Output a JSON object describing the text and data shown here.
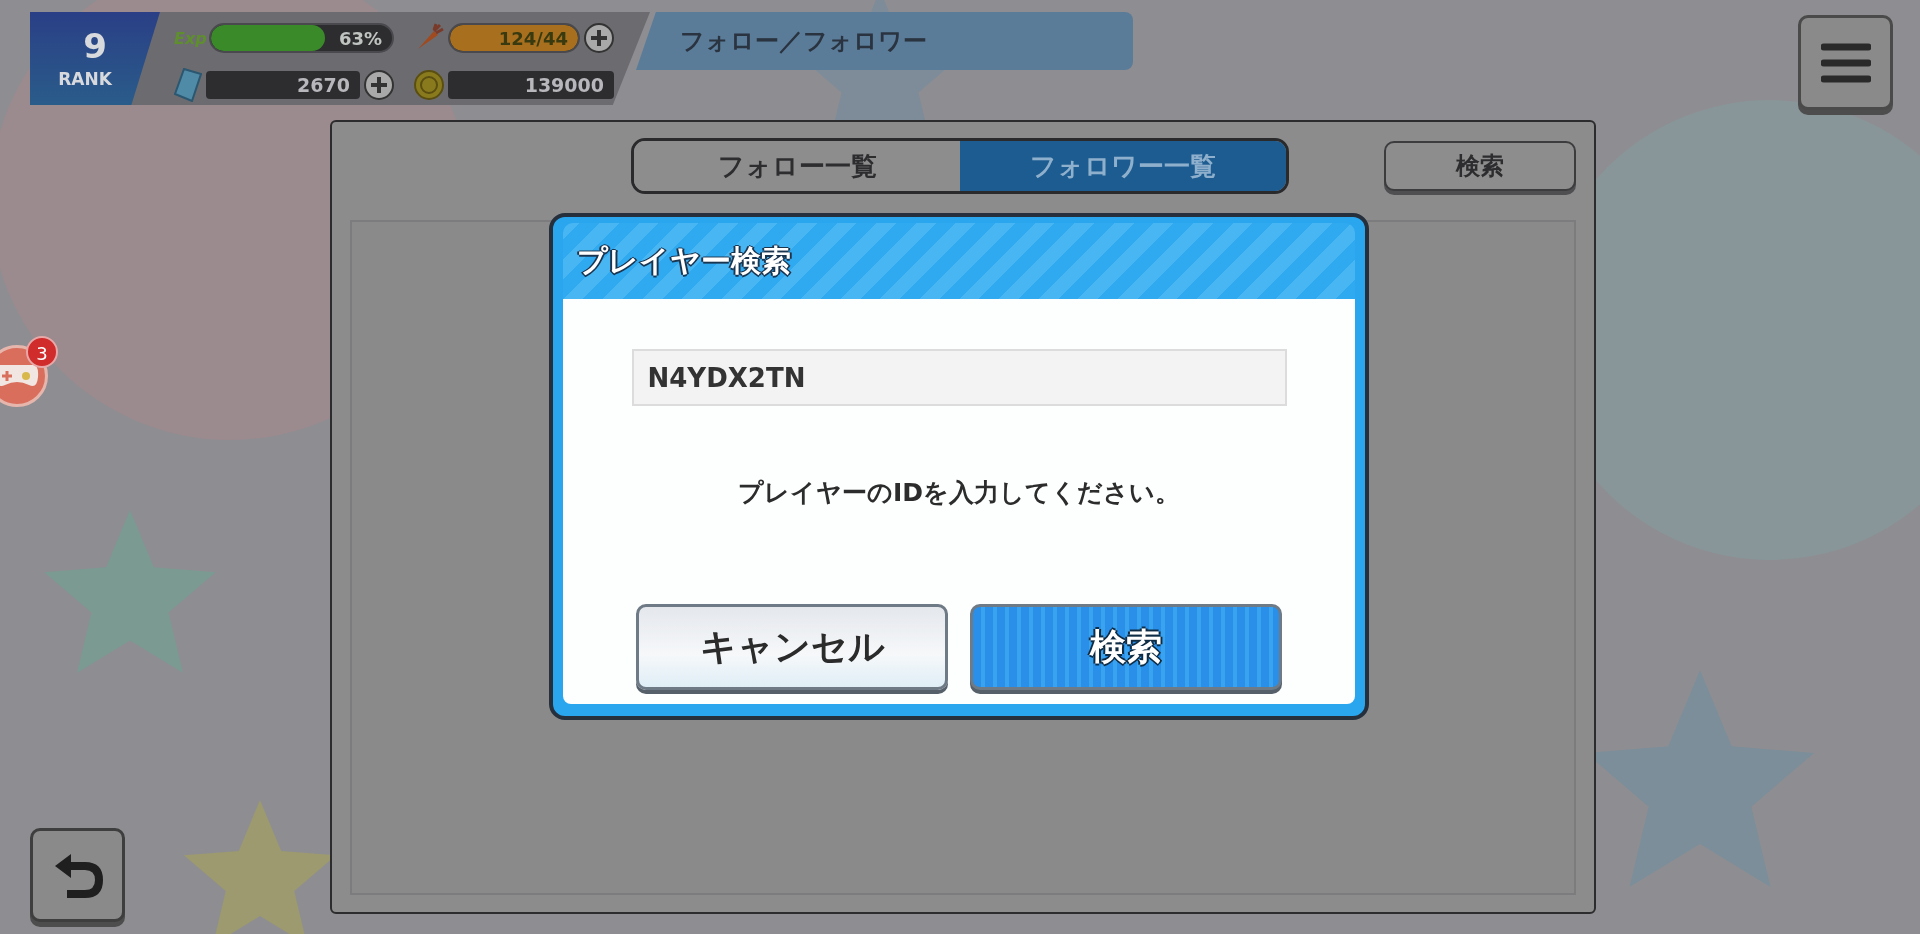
{
  "status": {
    "rank_value": "9",
    "rank_label": "RANK",
    "exp": {
      "label": "Exp",
      "level": 0.63,
      "text": "63%"
    },
    "stamina": {
      "level": 1,
      "text": "124/44"
    },
    "gems": "2670",
    "coins": "139000"
  },
  "title": "フォロー／フォロワー",
  "tabs": [
    {
      "label": "フォロー一覧",
      "selected": false
    },
    {
      "label": "フォロワー一覧",
      "selected": true
    }
  ],
  "search_button": "検索",
  "side_badge": "3",
  "dialog": {
    "title": "プレイヤー検索",
    "input_value": "N4YDX2TN",
    "message": "プレイヤーのIDを入力してください。",
    "buttons": [
      {
        "label": "キャンセル",
        "kind": "secondary"
      },
      {
        "label": "検索",
        "kind": "primary"
      }
    ]
  }
}
